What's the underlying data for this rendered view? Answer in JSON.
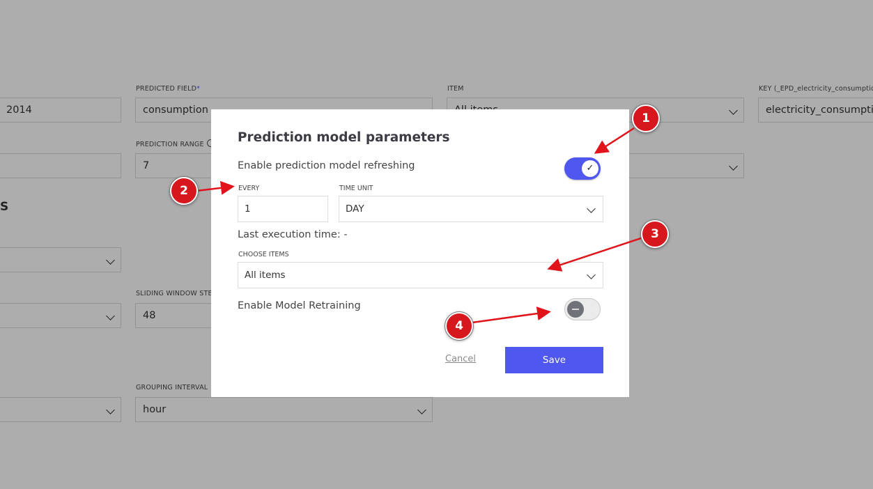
{
  "background_form": {
    "start_value": "2014",
    "predicted_field": {
      "label": "PREDICTED FIELD",
      "required_mark": "*",
      "value": "consumption"
    },
    "item": {
      "label": "ITEM",
      "value": "All items"
    },
    "key": {
      "label": "KEY (_EPD_electricity_consumption",
      "value": "electricity_consumptio"
    },
    "prediction_range": {
      "label": "PREDICTION RANGE",
      "value": "7"
    },
    "section_fragment": "S",
    "sliding_window_step": {
      "label": "SLIDING WINDOW STE",
      "value": "48"
    },
    "grouping_interval": {
      "label": "GROUPING INTERVAL",
      "value": "hour"
    }
  },
  "modal": {
    "title": "Prediction model parameters",
    "enable_refreshing_label": "Enable prediction model refreshing",
    "enable_refreshing_on": true,
    "toggle_check_glyph": "✓",
    "every": {
      "label": "EVERY",
      "value": "1"
    },
    "time_unit": {
      "label": "TIME UNIT",
      "value": "DAY"
    },
    "last_execution": "Last execution time: -",
    "choose_items": {
      "label": "CHOOSE ITEMS",
      "value": "All items"
    },
    "enable_retraining_label": "Enable Model Retraining",
    "enable_retraining_on": false,
    "cancel_label": "Cancel",
    "save_label": "Save"
  },
  "annotations": [
    "1",
    "2",
    "3",
    "4"
  ],
  "colors": {
    "accent": "#4f57ef",
    "annotation": "#d6181e",
    "overlay": "rgba(0,0,0,0.32)"
  }
}
